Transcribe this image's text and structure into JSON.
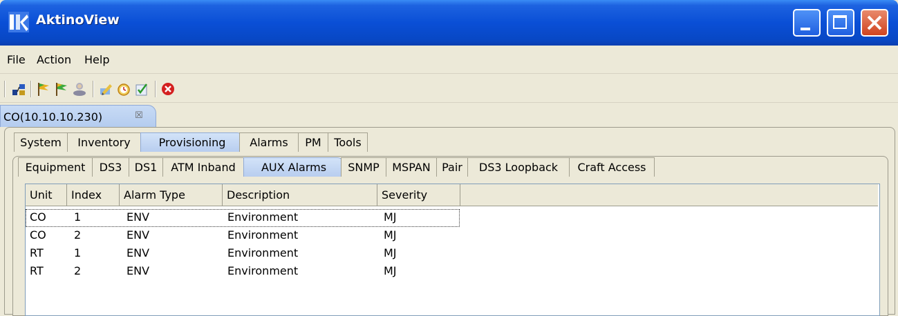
{
  "window": {
    "title": "AktinoView",
    "controls": [
      "minimize",
      "maximize",
      "close"
    ]
  },
  "menu": [
    "File",
    "Action",
    "Help"
  ],
  "toolbar": {
    "icons": [
      "network-map-icon",
      "flag-green-icon",
      "flag-yellow-icon",
      "users-icon",
      "edit-pencil-icon",
      "alarm-clock-icon",
      "checklist-icon",
      "stop-icon"
    ]
  },
  "doc_tab": {
    "label": "CO(10.10.10.230)",
    "close": "☒"
  },
  "main_tabs": [
    {
      "label": "System",
      "selected": false
    },
    {
      "label": "Inventory",
      "selected": false
    },
    {
      "label": "Provisioning",
      "selected": true
    },
    {
      "label": "Alarms",
      "selected": false
    },
    {
      "label": "PM",
      "selected": false
    },
    {
      "label": "Tools",
      "selected": false
    }
  ],
  "sub_tabs": [
    {
      "label": "Equipment",
      "selected": false
    },
    {
      "label": "DS3",
      "selected": false
    },
    {
      "label": "DS1",
      "selected": false
    },
    {
      "label": "ATM Inband",
      "selected": false
    },
    {
      "label": "AUX Alarms",
      "selected": true
    },
    {
      "label": "SNMP",
      "selected": false
    },
    {
      "label": "MSPAN",
      "selected": false
    },
    {
      "label": "Pair",
      "selected": false
    },
    {
      "label": "DS3 Loopback",
      "selected": false
    },
    {
      "label": "Craft Access",
      "selected": false
    }
  ],
  "table": {
    "columns": [
      "Unit",
      "Index",
      "Alarm Type",
      "Description",
      "Severity"
    ],
    "rows": [
      [
        "CO",
        "1",
        "ENV",
        "Environment",
        "MJ"
      ],
      [
        "CO",
        "2",
        "ENV",
        "Environment",
        "MJ"
      ],
      [
        "RT",
        "1",
        "ENV",
        "Environment",
        "MJ"
      ],
      [
        "RT",
        "2",
        "ENV",
        "Environment",
        "MJ"
      ]
    ]
  },
  "colors": {
    "titlebar": "#0a4fd6",
    "close_button": "#d04420",
    "selected_tab": "#b8cdef"
  }
}
